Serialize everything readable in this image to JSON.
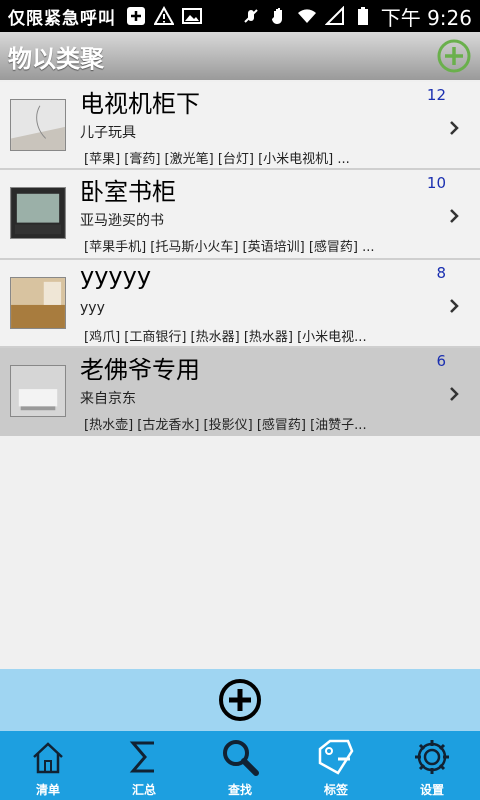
{
  "status_bar": {
    "notification_text": "仅限紧急呼叫",
    "time": "下午 9:26"
  },
  "header": {
    "title": "物以类聚"
  },
  "items": [
    {
      "name": "电视机柜下",
      "subtitle": "儿子玩具",
      "tags": "[苹果] [膏药] [激光笔] [台灯] [小米电视机] ...",
      "count": "12"
    },
    {
      "name": "卧室书柜",
      "subtitle": "亚马逊买的书",
      "tags": "[苹果手机] [托马斯小火车] [英语培训] [感冒药] ...",
      "count": "10"
    },
    {
      "name": "yyyyy",
      "subtitle": "yyy",
      "tags": "[鸡爪] [工商银行] [热水器] [热水器] [小米电视...",
      "count": "8"
    },
    {
      "name": "老佛爷专用",
      "subtitle": "来自京东",
      "tags": "[热水壶] [古龙香水] [投影仪] [感冒药] [油赞子...",
      "count": "6"
    }
  ],
  "bottom_nav": {
    "tabs": [
      {
        "label": "清单",
        "icon": "home-icon"
      },
      {
        "label": "汇总",
        "icon": "sigma-icon"
      },
      {
        "label": "查找",
        "icon": "search-icon"
      },
      {
        "label": "标签",
        "icon": "tag-icon"
      },
      {
        "label": "设置",
        "icon": "gear-icon"
      }
    ]
  },
  "colors": {
    "accent_green": "#6ab04c",
    "nav_blue": "#1d9fe0",
    "fab_bar": "#9fd5f2",
    "count_blue": "#1a2fb0"
  }
}
